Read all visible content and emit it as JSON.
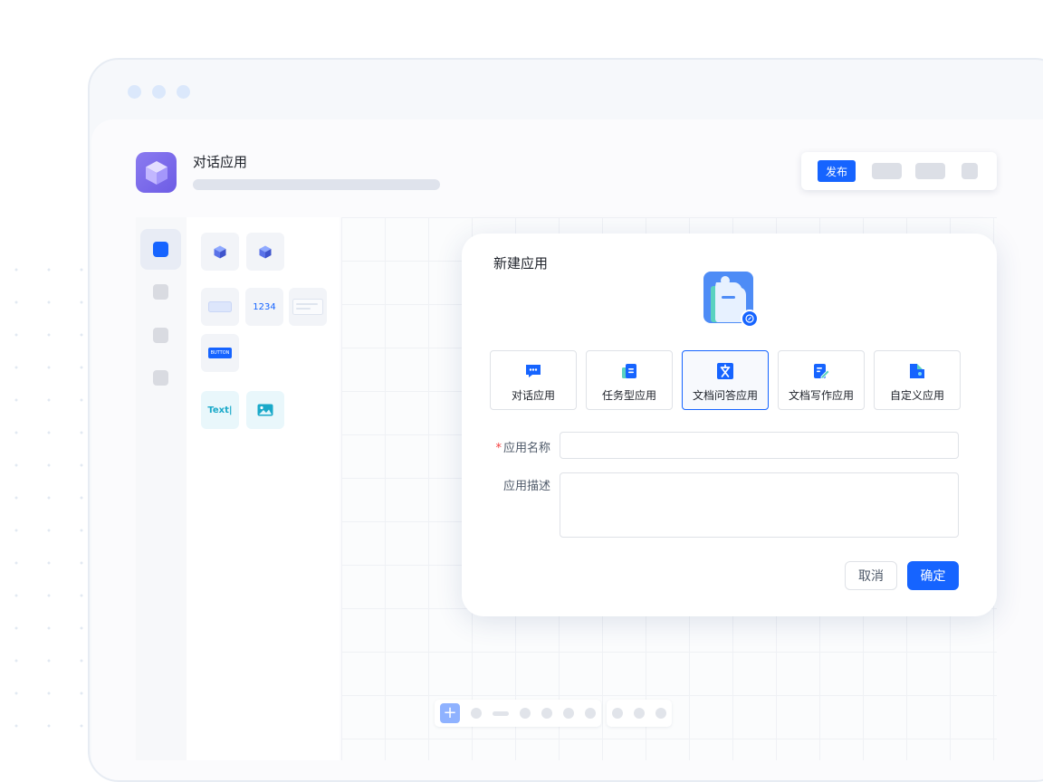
{
  "header": {
    "app_title": "对话应用",
    "publish_label": "发布"
  },
  "palette": {
    "number_widget": "1234",
    "button_widget": "BUTTON",
    "text_widget": "Text|"
  },
  "modal": {
    "title": "新建应用",
    "app_types": [
      {
        "label": "对话应用",
        "icon": "chat-bubble-icon",
        "selected": false
      },
      {
        "label": "任务型应用",
        "icon": "task-doc-icon",
        "selected": false
      },
      {
        "label": "文档问答应用",
        "icon": "doc-qa-icon",
        "selected": true
      },
      {
        "label": "文档写作应用",
        "icon": "doc-write-icon",
        "selected": false
      },
      {
        "label": "自定义应用",
        "icon": "puzzle-icon",
        "selected": false
      }
    ],
    "form": {
      "name_required_mark": "*",
      "name_label": "应用名称",
      "name_value": "",
      "desc_label": "应用描述",
      "desc_value": ""
    },
    "cancel_label": "取消",
    "confirm_label": "确定"
  },
  "colors": {
    "primary": "#1664ff",
    "app_icon": "#7b6cec",
    "big_icon": "#4e8cf6"
  }
}
